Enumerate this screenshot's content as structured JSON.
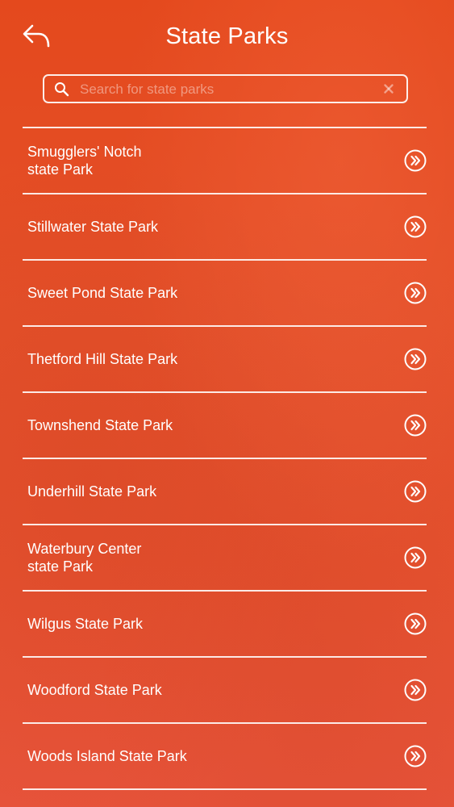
{
  "header": {
    "title": "State Parks",
    "back_icon": "reply-arrow-icon"
  },
  "search": {
    "placeholder": "Search for state parks",
    "value": "",
    "search_icon": "search-icon",
    "clear_icon": "close-icon"
  },
  "parks": {
    "item_icon": "chevron-double-right-circle-icon",
    "items": [
      {
        "label": "Smugglers' Notch\nstate Park"
      },
      {
        "label": "Stillwater State Park"
      },
      {
        "label": "Sweet Pond State Park"
      },
      {
        "label": "Thetford Hill State Park"
      },
      {
        "label": "Townshend State Park"
      },
      {
        "label": "Underhill State Park"
      },
      {
        "label": "Waterbury Center\nstate Park"
      },
      {
        "label": "Wilgus State Park"
      },
      {
        "label": "Woodford State Park"
      },
      {
        "label": "Woods Island State Park"
      }
    ]
  },
  "colors": {
    "background": "#e4491d",
    "foreground": "#ffffff"
  }
}
